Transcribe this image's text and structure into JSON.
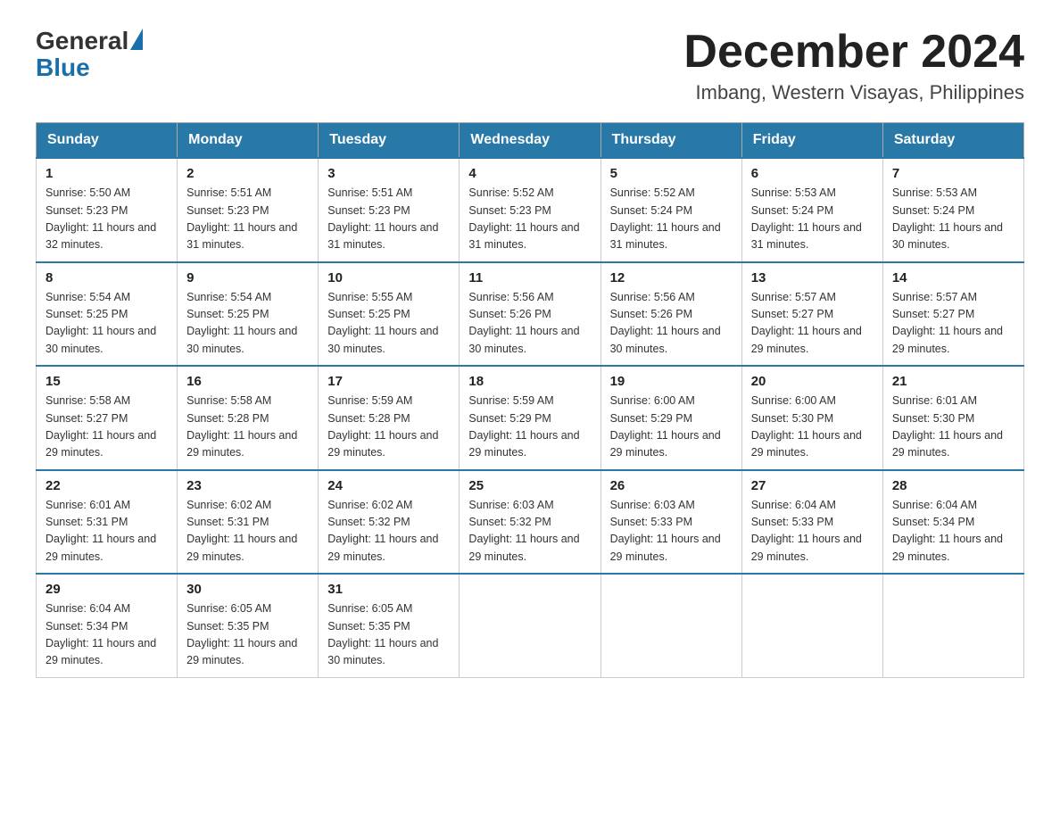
{
  "header": {
    "logo_general": "General",
    "logo_blue": "Blue",
    "month_title": "December 2024",
    "location": "Imbang, Western Visayas, Philippines"
  },
  "days_of_week": [
    "Sunday",
    "Monday",
    "Tuesday",
    "Wednesday",
    "Thursday",
    "Friday",
    "Saturday"
  ],
  "weeks": [
    [
      {
        "day": "1",
        "sunrise": "5:50 AM",
        "sunset": "5:23 PM",
        "daylight": "11 hours and 32 minutes."
      },
      {
        "day": "2",
        "sunrise": "5:51 AM",
        "sunset": "5:23 PM",
        "daylight": "11 hours and 31 minutes."
      },
      {
        "day": "3",
        "sunrise": "5:51 AM",
        "sunset": "5:23 PM",
        "daylight": "11 hours and 31 minutes."
      },
      {
        "day": "4",
        "sunrise": "5:52 AM",
        "sunset": "5:23 PM",
        "daylight": "11 hours and 31 minutes."
      },
      {
        "day": "5",
        "sunrise": "5:52 AM",
        "sunset": "5:24 PM",
        "daylight": "11 hours and 31 minutes."
      },
      {
        "day": "6",
        "sunrise": "5:53 AM",
        "sunset": "5:24 PM",
        "daylight": "11 hours and 31 minutes."
      },
      {
        "day": "7",
        "sunrise": "5:53 AM",
        "sunset": "5:24 PM",
        "daylight": "11 hours and 30 minutes."
      }
    ],
    [
      {
        "day": "8",
        "sunrise": "5:54 AM",
        "sunset": "5:25 PM",
        "daylight": "11 hours and 30 minutes."
      },
      {
        "day": "9",
        "sunrise": "5:54 AM",
        "sunset": "5:25 PM",
        "daylight": "11 hours and 30 minutes."
      },
      {
        "day": "10",
        "sunrise": "5:55 AM",
        "sunset": "5:25 PM",
        "daylight": "11 hours and 30 minutes."
      },
      {
        "day": "11",
        "sunrise": "5:56 AM",
        "sunset": "5:26 PM",
        "daylight": "11 hours and 30 minutes."
      },
      {
        "day": "12",
        "sunrise": "5:56 AM",
        "sunset": "5:26 PM",
        "daylight": "11 hours and 30 minutes."
      },
      {
        "day": "13",
        "sunrise": "5:57 AM",
        "sunset": "5:27 PM",
        "daylight": "11 hours and 29 minutes."
      },
      {
        "day": "14",
        "sunrise": "5:57 AM",
        "sunset": "5:27 PM",
        "daylight": "11 hours and 29 minutes."
      }
    ],
    [
      {
        "day": "15",
        "sunrise": "5:58 AM",
        "sunset": "5:27 PM",
        "daylight": "11 hours and 29 minutes."
      },
      {
        "day": "16",
        "sunrise": "5:58 AM",
        "sunset": "5:28 PM",
        "daylight": "11 hours and 29 minutes."
      },
      {
        "day": "17",
        "sunrise": "5:59 AM",
        "sunset": "5:28 PM",
        "daylight": "11 hours and 29 minutes."
      },
      {
        "day": "18",
        "sunrise": "5:59 AM",
        "sunset": "5:29 PM",
        "daylight": "11 hours and 29 minutes."
      },
      {
        "day": "19",
        "sunrise": "6:00 AM",
        "sunset": "5:29 PM",
        "daylight": "11 hours and 29 minutes."
      },
      {
        "day": "20",
        "sunrise": "6:00 AM",
        "sunset": "5:30 PM",
        "daylight": "11 hours and 29 minutes."
      },
      {
        "day": "21",
        "sunrise": "6:01 AM",
        "sunset": "5:30 PM",
        "daylight": "11 hours and 29 minutes."
      }
    ],
    [
      {
        "day": "22",
        "sunrise": "6:01 AM",
        "sunset": "5:31 PM",
        "daylight": "11 hours and 29 minutes."
      },
      {
        "day": "23",
        "sunrise": "6:02 AM",
        "sunset": "5:31 PM",
        "daylight": "11 hours and 29 minutes."
      },
      {
        "day": "24",
        "sunrise": "6:02 AM",
        "sunset": "5:32 PM",
        "daylight": "11 hours and 29 minutes."
      },
      {
        "day": "25",
        "sunrise": "6:03 AM",
        "sunset": "5:32 PM",
        "daylight": "11 hours and 29 minutes."
      },
      {
        "day": "26",
        "sunrise": "6:03 AM",
        "sunset": "5:33 PM",
        "daylight": "11 hours and 29 minutes."
      },
      {
        "day": "27",
        "sunrise": "6:04 AM",
        "sunset": "5:33 PM",
        "daylight": "11 hours and 29 minutes."
      },
      {
        "day": "28",
        "sunrise": "6:04 AM",
        "sunset": "5:34 PM",
        "daylight": "11 hours and 29 minutes."
      }
    ],
    [
      {
        "day": "29",
        "sunrise": "6:04 AM",
        "sunset": "5:34 PM",
        "daylight": "11 hours and 29 minutes."
      },
      {
        "day": "30",
        "sunrise": "6:05 AM",
        "sunset": "5:35 PM",
        "daylight": "11 hours and 29 minutes."
      },
      {
        "day": "31",
        "sunrise": "6:05 AM",
        "sunset": "5:35 PM",
        "daylight": "11 hours and 30 minutes."
      },
      null,
      null,
      null,
      null
    ]
  ]
}
